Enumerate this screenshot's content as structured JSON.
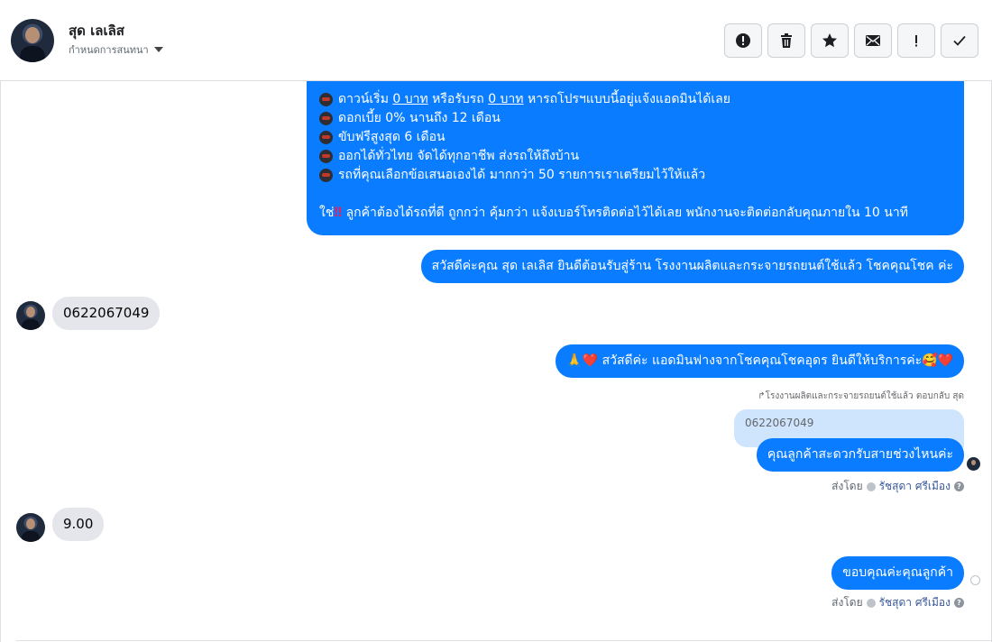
{
  "header": {
    "contact_name": "สุด เลเลิส",
    "assign_label": "กำหนดการสนทนา",
    "toolbar": [
      {
        "name": "spam-button",
        "icon": "alert-circle-icon"
      },
      {
        "name": "delete-button",
        "icon": "trash-icon"
      },
      {
        "name": "star-button",
        "icon": "star-icon"
      },
      {
        "name": "mark-unread-button",
        "icon": "envelope-icon"
      },
      {
        "name": "follow-up-button",
        "icon": "exclamation-icon"
      },
      {
        "name": "done-button",
        "icon": "check-icon"
      }
    ]
  },
  "messages": {
    "promo": {
      "l1_a": "ดาวน์เริ่ม",
      "l1_b": "0 บาท",
      "l1_c": "หรือรับรถ",
      "l1_d": "0 บาท",
      "l1_e": "หารถโปรฯแบบนี้อยู่แจ้งแอดมินได้เลย",
      "l2": "ดอกเบี้ย 0% นานถึง 12 เดือน",
      "l3": "ขับฟรีสูงสุด 6 เดือน",
      "l4": "ออกได้ทั่วไทย จัดได้ทุกอาชีพ ส่งรถให้ถึงบ้าน",
      "l5": "รถที่คุณเลือกข้อเสนอเองได้ มากกว่า 50 รายการเราเตรียมไว้ให้แล้ว",
      "l6_a": "ใช่",
      "l6_bang": "‼",
      "l6_b": "ลูกค้าต้องได้รถที่ดี ถูกกว่า คุ้มกว่า แจ้งเบอร์โทรติดต่อไว้ได้เลย พนักงานจะติดต่อกลับคุณภายใน 10 นาที"
    },
    "welcome": "สวัสดีค่ะคุณ สุด เลเลิส ยินดีต้อนรับสู่ร้าน โรงงานผลิตและกระจายรถยนต์ใช้แล้ว โชคคุณโชค ค่ะ",
    "customer_phone": "0622067049",
    "admin_greeting": "🙏❤️ สวัสดีค่ะ แอดมินฟางจากโชคคุณโชคอุดร ยินดีให้บริการค่ะ🥰❤️",
    "reply_meta": "↱โรงงานผลิตและกระจายรถยนต์ใช้แล้ว ตอบกลับ สุด",
    "quoted_text": "0622067049",
    "ask_time": "คุณลูกค้าสะดวกรับสายช่วงไหนค่ะ",
    "sent_by_label": "ส่งโดย",
    "sender_name": "รัชสุดา ศรีเมือง",
    "help_mark": "?",
    "customer_time": "9.00",
    "thanks": "ขอบคุณค่ะคุณลูกค้า"
  },
  "colors": {
    "outgoing_bubble": "#0a7cff",
    "incoming_bubble": "#e4e6eb",
    "quoted_bubble": "#cfe4fd"
  }
}
